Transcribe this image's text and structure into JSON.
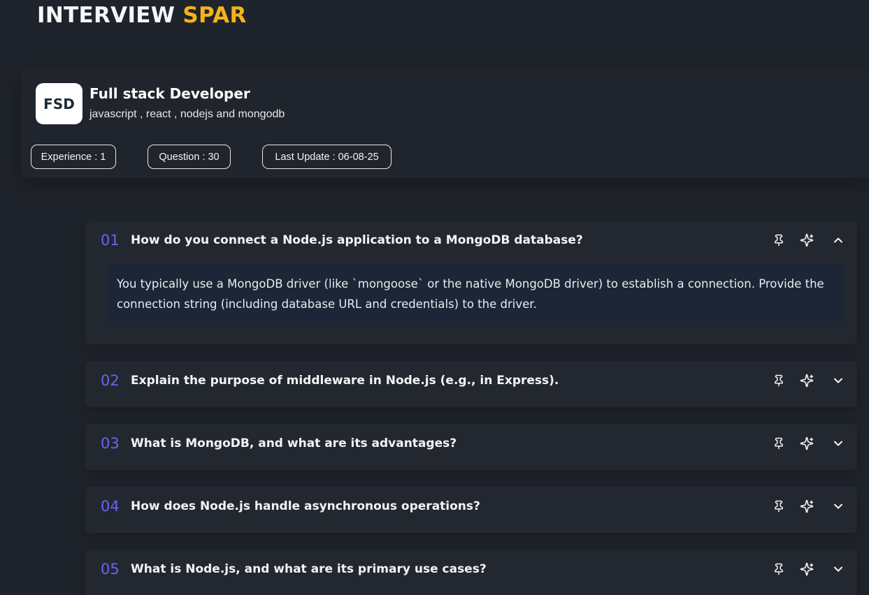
{
  "brand": {
    "word": "INTERVIEW",
    "accent": "SPAR"
  },
  "profile": {
    "initials": "FSD",
    "title": "Full stack Developer",
    "topics": "javascript , react , nodejs and mongodb",
    "experience": "Experience : 1",
    "questions": "Question : 30",
    "last_update": "Last Update : 06-08-25"
  },
  "icons": {
    "pin": "pin-icon",
    "sparkle": "sparkle-icon",
    "expand": "chevron-down-icon",
    "collapse": "chevron-up-icon"
  },
  "colors": {
    "accent": "#f5b21a",
    "number": "#6b63f0",
    "background": "#1f232b",
    "answer_bg": "#1c2636"
  },
  "questions": [
    {
      "num": "01",
      "text": "How do you connect a Node.js application to a MongoDB database?",
      "expanded": true,
      "answer": "You typically use a MongoDB driver (like `mongoose` or the native MongoDB driver) to establish a connection. Provide the connection string (including database URL and credentials) to the driver."
    },
    {
      "num": "02",
      "text": "Explain the purpose of middleware in Node.js (e.g., in Express).",
      "expanded": false
    },
    {
      "num": "03",
      "text": "What is MongoDB, and what are its advantages?",
      "expanded": false
    },
    {
      "num": "04",
      "text": "How does Node.js handle asynchronous operations?",
      "expanded": false
    },
    {
      "num": "05",
      "text": "What is Node.js, and what are its primary use cases?",
      "expanded": false
    }
  ]
}
